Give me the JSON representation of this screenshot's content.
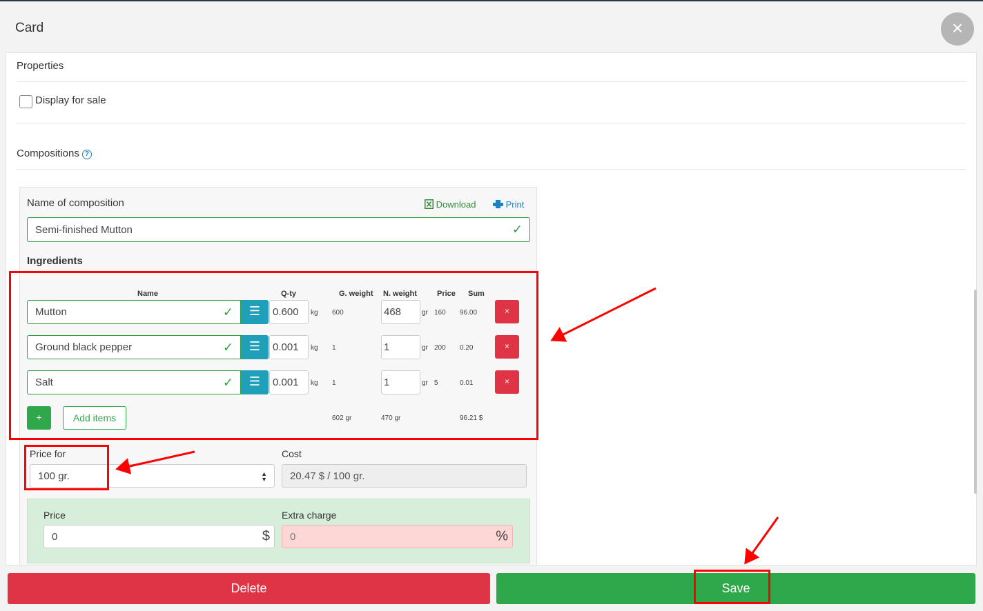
{
  "header": {
    "title": "Card",
    "close_icon": "×"
  },
  "properties": {
    "heading": "Properties",
    "display_for_sale_label": "Display for sale"
  },
  "compositions": {
    "heading": "Compositions",
    "name_label": "Name of composition",
    "download_label": "Download",
    "print_label": "Print",
    "name_value": "Semi-finished Mutton",
    "ingredients_heading": "Ingredients",
    "columns": {
      "name": "Name",
      "qty": "Q-ty",
      "gweight": "G. weight",
      "nweight": "N. weight",
      "price": "Price",
      "sum": "Sum"
    },
    "rows": [
      {
        "name": "Mutton",
        "qty": "0.600",
        "qty_unit": "kg",
        "gweight": "600",
        "nweight": "468",
        "nweight_unit": "gr",
        "price": "160",
        "sum": "96.00"
      },
      {
        "name": "Ground black pepper",
        "qty": "0.001",
        "qty_unit": "kg",
        "gweight": "1",
        "nweight": "1",
        "nweight_unit": "gr",
        "price": "200",
        "sum": "0.20"
      },
      {
        "name": "Salt",
        "qty": "0.001",
        "qty_unit": "kg",
        "gweight": "1",
        "nweight": "1",
        "nweight_unit": "gr",
        "price": "5",
        "sum": "0.01"
      }
    ],
    "plus_label": "+",
    "add_items_label": "Add items",
    "totals": {
      "gweight": "602 gr",
      "nweight": "470 gr",
      "sum": "96.21 $"
    },
    "delete_icon": "×",
    "list_icon": "☰",
    "check_icon": "✓"
  },
  "pricing": {
    "price_for_label": "Price for",
    "price_for_value": "100 gr.",
    "cost_label": "Cost",
    "cost_value": "20.47 $ / 100 gr.",
    "price_label": "Price",
    "price_value": "0",
    "price_suffix": "$",
    "extra_charge_label": "Extra charge",
    "extra_charge_value": "0",
    "extra_charge_suffix": "%"
  },
  "footer": {
    "delete_label": "Delete",
    "save_label": "Save"
  },
  "colors": {
    "danger": "#df3446",
    "success": "#2ea84a",
    "info": "#1fa0b8",
    "annotation": "#ff0000"
  }
}
